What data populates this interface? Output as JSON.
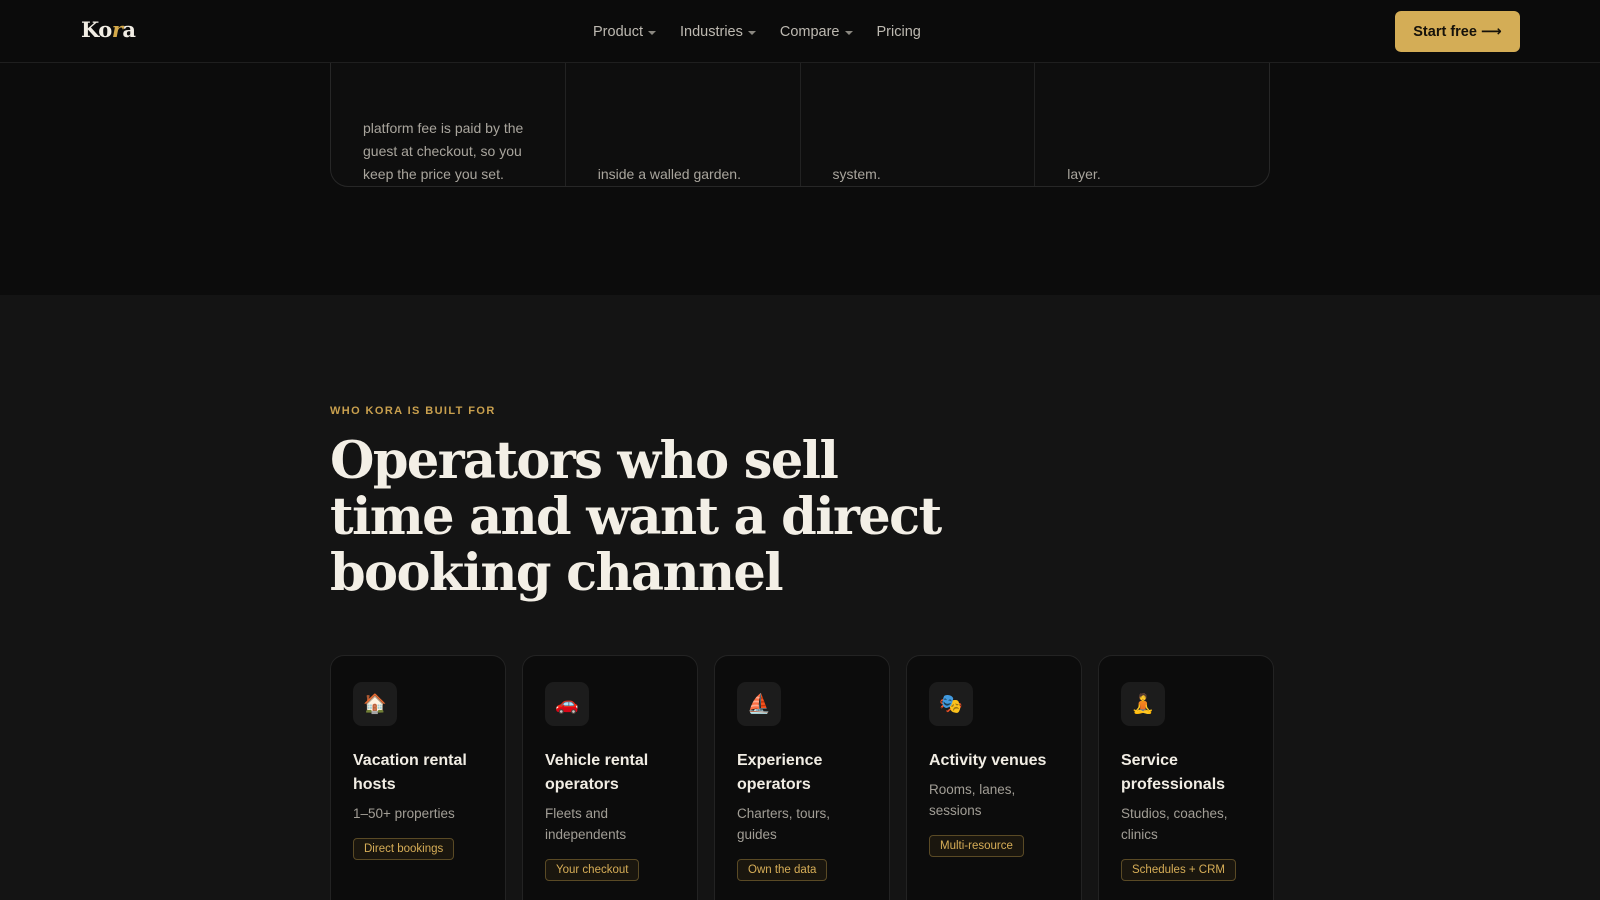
{
  "header": {
    "logo_prefix": "Ko",
    "logo_accent": "r",
    "logo_suffix": "a",
    "nav": [
      {
        "label": "Product",
        "has_dropdown": true
      },
      {
        "label": "Industries",
        "has_dropdown": true
      },
      {
        "label": "Compare",
        "has_dropdown": true
      },
      {
        "label": "Pricing",
        "has_dropdown": false
      }
    ],
    "cta_label": "Start free",
    "cta_arrow": "⟶"
  },
  "top_cards": [
    {
      "text": "platform fee is paid by the guest at checkout, so you keep the price you set."
    },
    {
      "text": "inside a walled garden."
    },
    {
      "text": "system."
    },
    {
      "text": "layer."
    }
  ],
  "built_for": {
    "eyebrow": "WHO KORA IS BUILT FOR",
    "headline": "Operators who sell time and want a direct booking channel",
    "cards": [
      {
        "icon": "house-icon",
        "emoji": "🏠",
        "title": "Vacation rental hosts",
        "subtitle": "1–50+ properties",
        "tag": "Direct bookings"
      },
      {
        "icon": "car-icon",
        "emoji": "🚗",
        "title": "Vehicle rental operators",
        "subtitle": "Fleets and independents",
        "tag": "Your checkout"
      },
      {
        "icon": "sailboat-icon",
        "emoji": "⛵",
        "title": "Experience operators",
        "subtitle": "Charters, tours, guides",
        "tag": "Own the data"
      },
      {
        "icon": "theater-masks-icon",
        "emoji": "🎭",
        "title": "Activity venues",
        "subtitle": "Rooms, lanes, sessions",
        "tag": "Multi-resource"
      },
      {
        "icon": "meditation-icon",
        "emoji": "🧘",
        "title": "Service professionals",
        "subtitle": "Studios, coaches, clinics",
        "tag": "Schedules + CRM"
      }
    ]
  },
  "colors": {
    "accent": "#d4ad56",
    "page_bg": "#0c0c0c",
    "section_bg": "#141414"
  }
}
